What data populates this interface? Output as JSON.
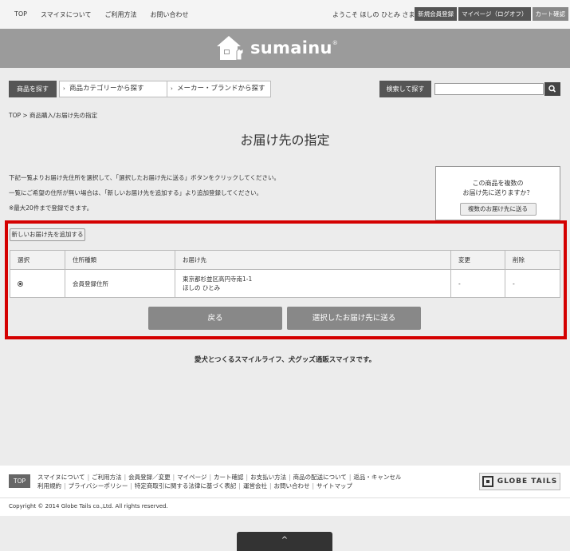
{
  "topnav": [
    "TOP",
    "スマイヌについて",
    "ご利用方法",
    "お問い合わせ"
  ],
  "welcome": "ようこそ ほしの ひとみ さま",
  "topbuttons": {
    "register": "新規会員登録",
    "mypage": "マイページ（ログオフ）",
    "cart": "カート確認"
  },
  "logo": {
    "text": "sumainu",
    "reg": "®"
  },
  "search": {
    "products_btn": "商品を探す",
    "categories": [
      "商品カテゴリーから探す",
      "メーカー・ブランドから探す"
    ],
    "search_label": "検索して探す",
    "query": "",
    "placeholder": ""
  },
  "breadcrumb": "TOP > 商品購入/お届け先の指定",
  "title": "お届け先の指定",
  "instructions": [
    "下記一覧よりお届け先住所を選択して、「選択したお届け先に送る」ボタンをクリックしてください。",
    "一覧にご希望の住所が無い場合は、「新しいお届け先を追加する」より追加登録してください。",
    "※最大20件まで登録できます。"
  ],
  "multi": {
    "line1": "この商品を複数の",
    "line2": "お届け先に送りますか？",
    "button": "複数のお届け先に送る"
  },
  "add_button": "新しいお届け先を追加する",
  "table": {
    "headers": [
      "選択",
      "住所種類",
      "お届け先",
      "変更",
      "削除"
    ],
    "row": {
      "selected": true,
      "type": "会員登録住所",
      "address": "東京都杉並区高円寺南1-1",
      "name": "ほしの ひとみ",
      "edit": "-",
      "delete": "-"
    }
  },
  "back_button": "戻る",
  "send_button": "選択したお届け先に送る",
  "tagline": "愛犬とつくるスマイルライフ、犬グッズ通販スマイヌです。",
  "footer": {
    "top": "TOP",
    "links_row1": [
      "スマイヌについて",
      "ご利用方法",
      "会員登録／変更",
      "マイページ",
      "カート確認",
      "お支払い方法",
      "商品の配送について",
      "返品・キャンセル"
    ],
    "links_row2": [
      "利用規約",
      "プライバシーポリシー",
      "特定商取引に関する法律に基づく表記",
      "運営会社",
      "お問い合わせ",
      "サイトマップ"
    ],
    "brand": "GLOBE TAILS",
    "copyright": "Copyright © 2014 Globe Tails co.,Ltd. All rights reserved."
  },
  "pagetop": "^"
}
